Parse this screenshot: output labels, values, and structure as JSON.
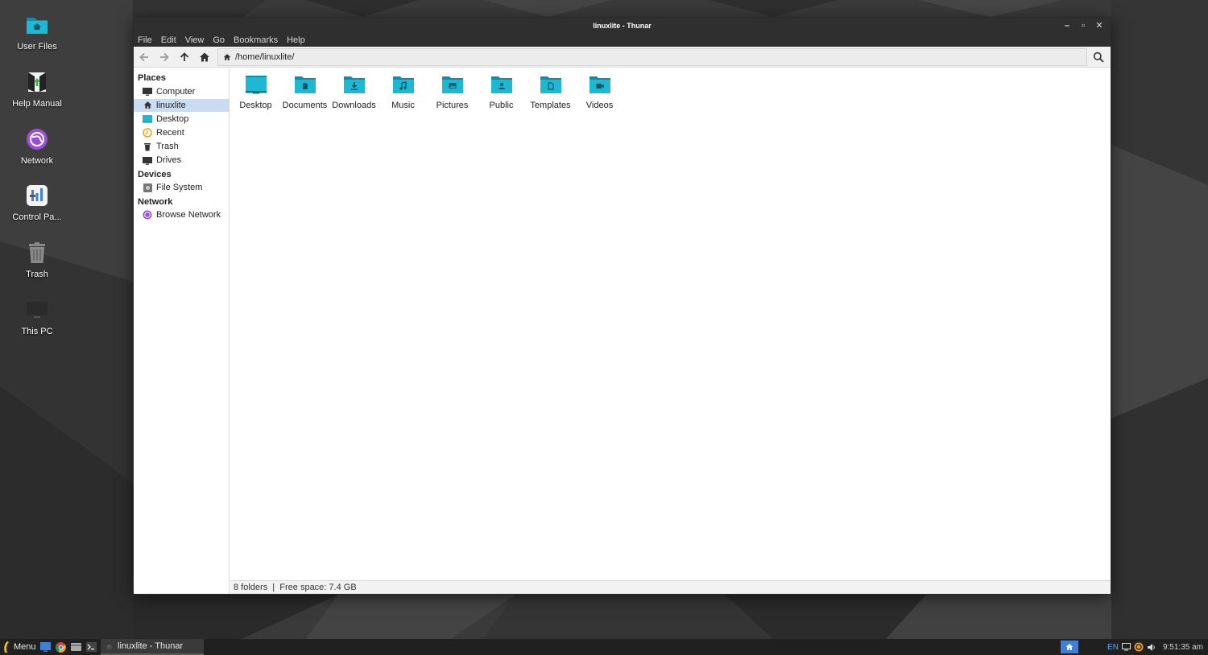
{
  "desktop": {
    "icons": [
      {
        "label": "User Files",
        "icon": "home-folder-icon"
      },
      {
        "label": "Help Manual",
        "icon": "help-manual-icon"
      },
      {
        "label": "Network",
        "icon": "network-icon"
      },
      {
        "label": "Control Pa...",
        "icon": "control-panel-icon"
      },
      {
        "label": "Trash",
        "icon": "trash-icon"
      },
      {
        "label": "This PC",
        "icon": "computer-icon"
      }
    ]
  },
  "window": {
    "title": "linuxlite - Thunar",
    "menu": [
      "File",
      "Edit",
      "View",
      "Go",
      "Bookmarks",
      "Help"
    ],
    "location": "/home/linuxlite/",
    "sidebar": {
      "places_header": "Places",
      "places": [
        {
          "label": "Computer",
          "icon": "computer-icon"
        },
        {
          "label": "linuxlite",
          "icon": "home-icon",
          "selected": true
        },
        {
          "label": "Desktop",
          "icon": "desktop-icon"
        },
        {
          "label": "Recent",
          "icon": "recent-icon"
        },
        {
          "label": "Trash",
          "icon": "trash-icon"
        },
        {
          "label": "Drives",
          "icon": "drives-icon"
        }
      ],
      "devices_header": "Devices",
      "devices": [
        {
          "label": "File System",
          "icon": "harddisk-icon"
        }
      ],
      "network_header": "Network",
      "network": [
        {
          "label": "Browse Network",
          "icon": "network-icon"
        }
      ]
    },
    "folders": [
      {
        "label": "Desktop",
        "icon": "desktop-folder-icon"
      },
      {
        "label": "Documents",
        "icon": "documents-folder-icon"
      },
      {
        "label": "Downloads",
        "icon": "downloads-folder-icon"
      },
      {
        "label": "Music",
        "icon": "music-folder-icon"
      },
      {
        "label": "Pictures",
        "icon": "pictures-folder-icon"
      },
      {
        "label": "Public",
        "icon": "public-folder-icon"
      },
      {
        "label": "Templates",
        "icon": "templates-folder-icon"
      },
      {
        "label": "Videos",
        "icon": "videos-folder-icon"
      }
    ],
    "status": "8 folders  |  Free space: 7.4 GB"
  },
  "taskbar": {
    "menu_label": "Menu",
    "task_label": "linuxlite - Thunar",
    "lang": "EN",
    "clock": "9:51:35 am"
  },
  "colors": {
    "folder": "#1fb8d3",
    "folder_dark": "#0e8ea6",
    "selection": "#c9dcf4",
    "titlebar": "#2f2f2f",
    "taskbar": "#202020"
  }
}
